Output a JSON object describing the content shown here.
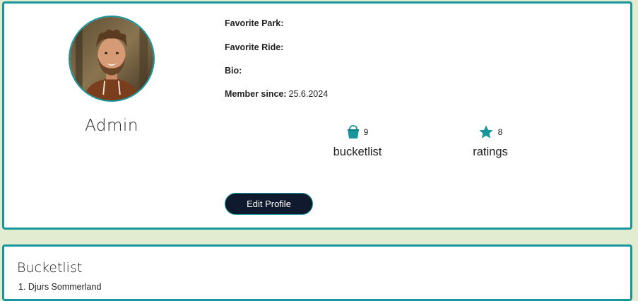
{
  "profile": {
    "username": "Admin",
    "favorite_park_label": "Favorite Park:",
    "favorite_park_value": "",
    "favorite_ride_label": "Favorite Ride:",
    "favorite_ride_value": "",
    "bio_label": "Bio:",
    "bio_value": "",
    "member_since_label": "Member since:",
    "member_since_value": "25.6.2024"
  },
  "stats": {
    "bucketlist_count": "9",
    "bucketlist_label": "bucketlist",
    "bucketlist_icon": "bucket-icon",
    "ratings_count": "8",
    "ratings_label": "ratings",
    "ratings_icon": "star-icon"
  },
  "actions": {
    "edit_profile_label": "Edit Profile"
  },
  "bucketlist": {
    "title": "Bucketlist",
    "items": [
      "1. Djurs Sommerland"
    ]
  },
  "colors": {
    "accent": "#16959a",
    "button_bg": "#101a2e",
    "page_bg": "#e2ecd0"
  }
}
